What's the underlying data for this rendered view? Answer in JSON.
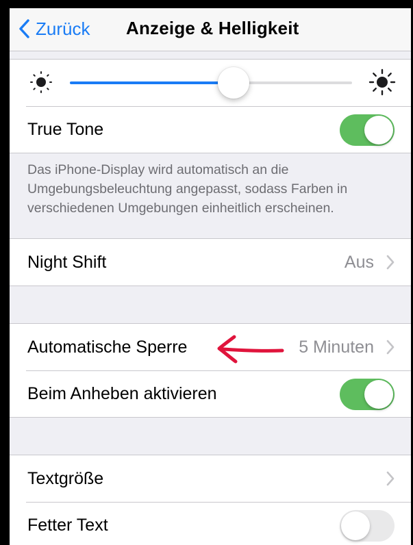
{
  "nav": {
    "back_label": "Zurück",
    "title": "Anzeige & Helligkeit"
  },
  "brightness": {
    "level": 0.58,
    "min_icon": "sun-small-icon",
    "max_icon": "sun-large-icon"
  },
  "true_tone": {
    "label": "True Tone",
    "enabled": true,
    "footnote": "Das iPhone-Display wird automatisch an die Umgebungsbeleuchtung angepasst, sodass Farben in verschiedenen Umgebungen einheitlich erscheinen."
  },
  "night_shift": {
    "label": "Night Shift",
    "value": "Aus"
  },
  "auto_lock": {
    "label": "Automatische Sperre",
    "value": "5 Minuten"
  },
  "raise_to_wake": {
    "label": "Beim Anheben aktivieren",
    "enabled": true
  },
  "text_size": {
    "label": "Textgröße"
  },
  "bold_text": {
    "label": "Fetter Text",
    "enabled": false
  },
  "annotation": {
    "icon": "red-arrow-icon",
    "color": "#e0143c"
  },
  "colors": {
    "accent": "#1a7cf5",
    "toggle_on": "#5ebd5e",
    "toggle_off": "#e9e9ea",
    "secondary_text": "#8e8e93"
  }
}
